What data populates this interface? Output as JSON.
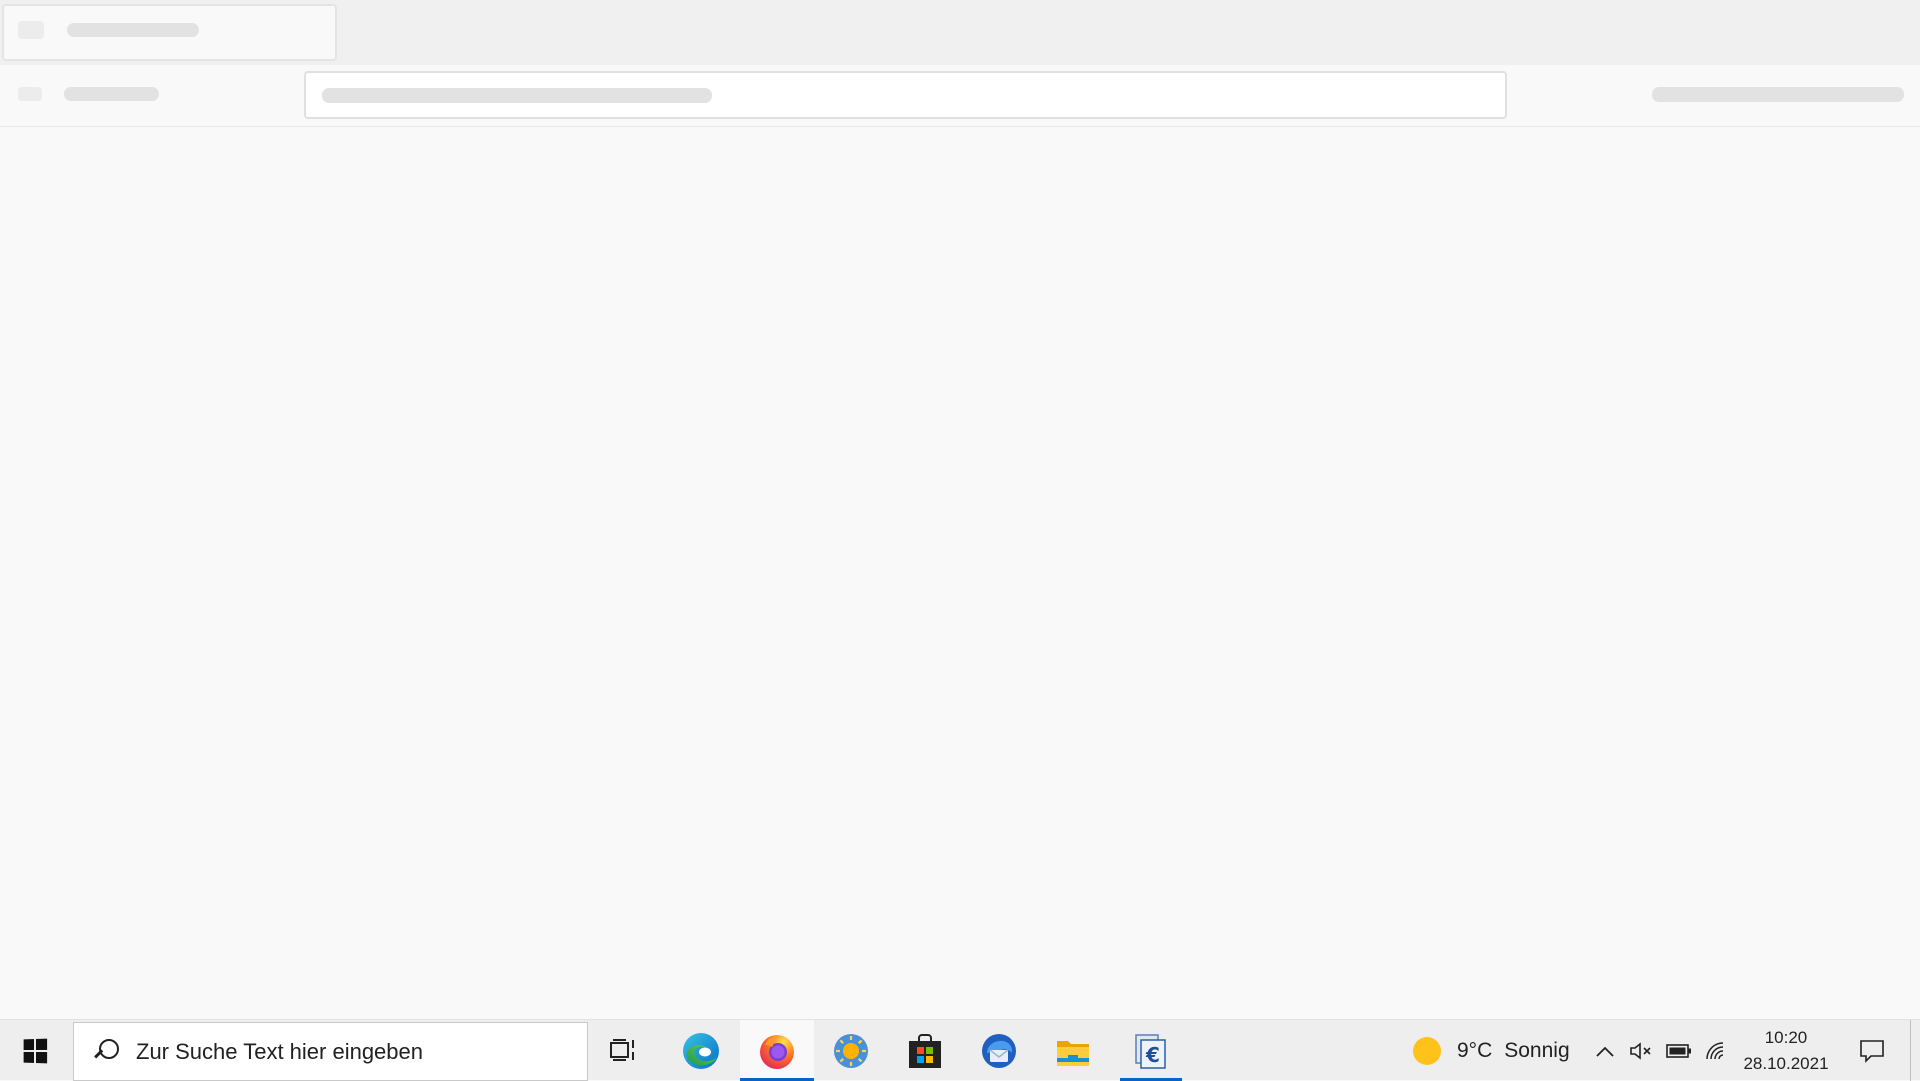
{
  "browser": {
    "state": "loading-skeleton",
    "tab_title": "",
    "url": ""
  },
  "taskbar": {
    "search": {
      "placeholder": "Zur Suche Text hier eingeben"
    },
    "apps": [
      {
        "name": "Microsoft Edge",
        "icon": "edge-icon",
        "state": "pinned"
      },
      {
        "name": "Firefox",
        "icon": "firefox-icon",
        "state": "active"
      },
      {
        "name": "Weather app",
        "icon": "sun-app-icon",
        "state": "pinned"
      },
      {
        "name": "Microsoft Store",
        "icon": "store-icon",
        "state": "pinned"
      },
      {
        "name": "Thunderbird",
        "icon": "thunderbird-icon",
        "state": "pinned"
      },
      {
        "name": "File Explorer",
        "icon": "folder-icon",
        "state": "pinned"
      },
      {
        "name": "Finance app",
        "icon": "euro-document-icon",
        "state": "running"
      }
    ],
    "weather": {
      "temperature": "9°C",
      "condition": "Sonnig"
    },
    "clock": {
      "time": "10:20",
      "date": "28.10.2021"
    },
    "tray_icons": [
      "chevron-up-icon",
      "speaker-muted-icon",
      "battery-icon",
      "wifi-icon",
      "notification-icon"
    ]
  },
  "colors": {
    "taskbar_bg": "#eeeeee",
    "accent": "#0a63c9",
    "page_bg": "#f9f9f9"
  }
}
